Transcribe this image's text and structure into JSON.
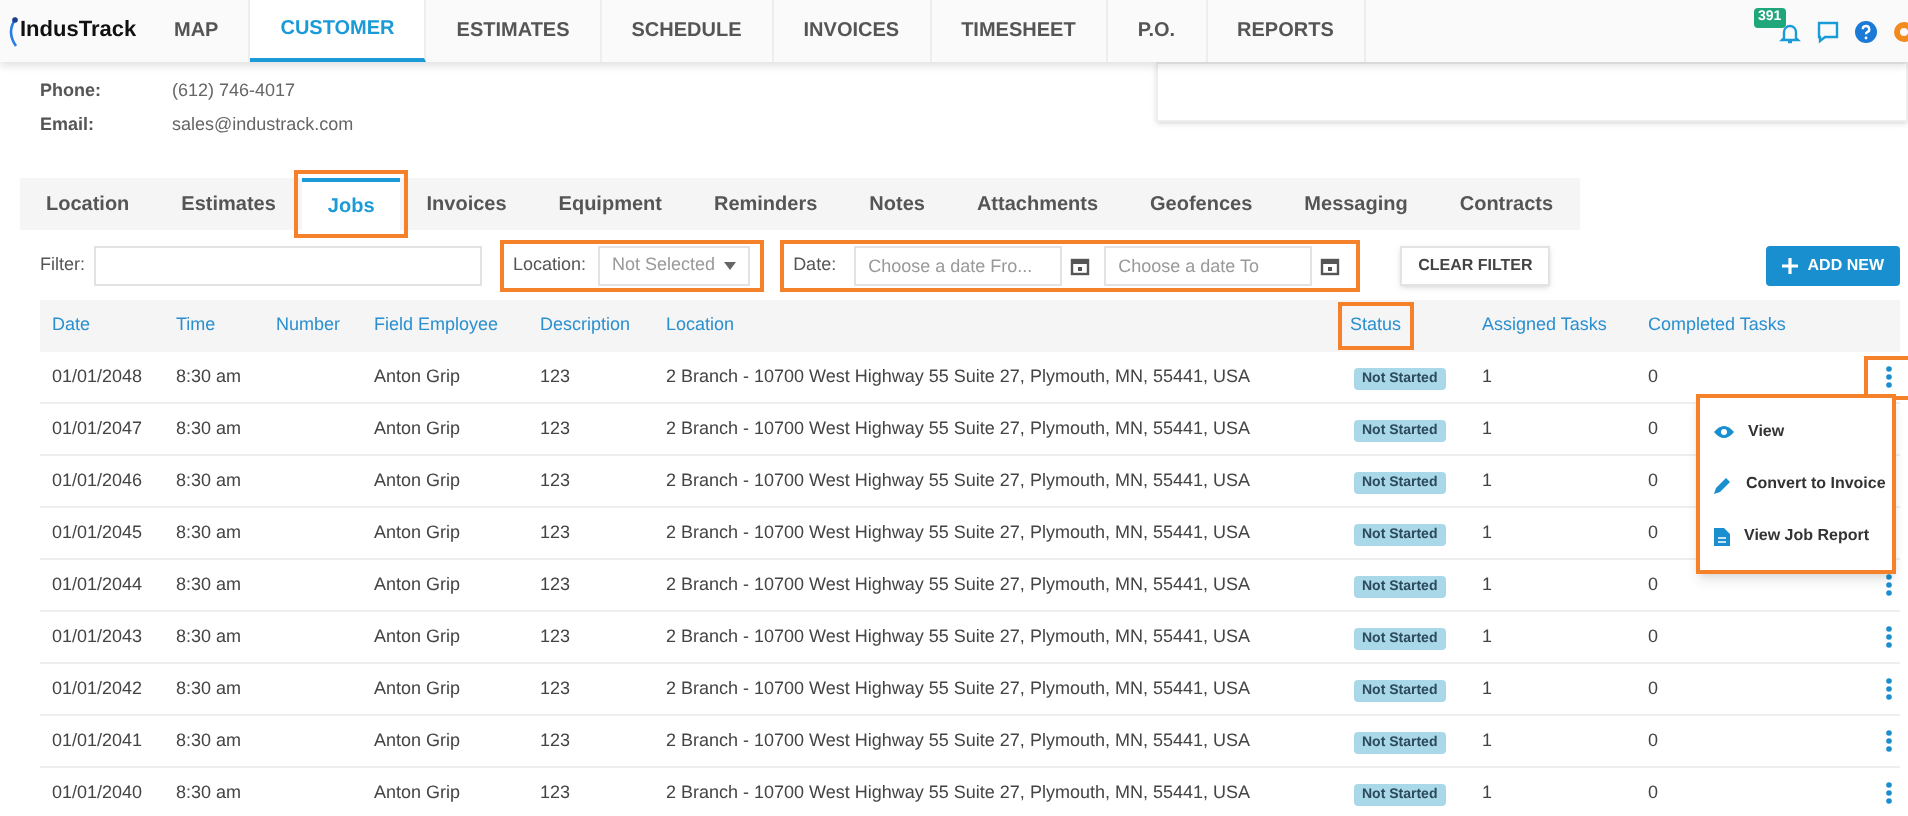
{
  "logo": "IndusTrack",
  "nav": [
    {
      "label": "MAP",
      "selected": false
    },
    {
      "label": "CUSTOMER",
      "selected": true
    },
    {
      "label": "ESTIMATES",
      "selected": false
    },
    {
      "label": "SCHEDULE",
      "selected": false
    },
    {
      "label": "INVOICES",
      "selected": false
    },
    {
      "label": "TIMESHEET",
      "selected": false
    },
    {
      "label": "P.O.",
      "selected": false
    },
    {
      "label": "REPORTS",
      "selected": false
    }
  ],
  "notification_count": "391",
  "contact": [
    {
      "label": "Phone:",
      "value": "(612) 746-4017"
    },
    {
      "label": "Email:",
      "value": "sales@industrack.com"
    }
  ],
  "tabs": [
    {
      "label": "Location",
      "selected": false,
      "highlighted": false
    },
    {
      "label": "Estimates",
      "selected": false,
      "highlighted": false
    },
    {
      "label": "Jobs",
      "selected": true,
      "highlighted": true
    },
    {
      "label": "Invoices",
      "selected": false,
      "highlighted": false
    },
    {
      "label": "Equipment",
      "selected": false,
      "highlighted": false
    },
    {
      "label": "Reminders",
      "selected": false,
      "highlighted": false
    },
    {
      "label": "Notes",
      "selected": false,
      "highlighted": false
    },
    {
      "label": "Attachments",
      "selected": false,
      "highlighted": false
    },
    {
      "label": "Geofences",
      "selected": false,
      "highlighted": false
    },
    {
      "label": "Messaging",
      "selected": false,
      "highlighted": false
    },
    {
      "label": "Contracts",
      "selected": false,
      "highlighted": false
    }
  ],
  "filters": {
    "filter_label": "Filter:",
    "location_label": "Location:",
    "location_value": "Not Selected",
    "date_label": "Date:",
    "date_from_placeholder": "Choose a date Fro...",
    "date_to_placeholder": "Choose a date To",
    "clear_button": "CLEAR FILTER",
    "add_button": "ADD NEW"
  },
  "columns": [
    {
      "label": "Date",
      "highlighted": false
    },
    {
      "label": "Time",
      "highlighted": false
    },
    {
      "label": "Number",
      "highlighted": false
    },
    {
      "label": "Field Employee",
      "highlighted": false
    },
    {
      "label": "Description",
      "highlighted": false
    },
    {
      "label": "Location",
      "highlighted": false
    },
    {
      "label": "Status",
      "highlighted": true
    },
    {
      "label": "Assigned Tasks",
      "highlighted": false
    },
    {
      "label": "Completed Tasks",
      "highlighted": false
    }
  ],
  "rows": [
    {
      "date": "01/01/2048",
      "time": "8:30 am",
      "employee": "Anton Grip",
      "description": "123",
      "location": "2 Branch - 10700 West Highway 55 Suite 27, Plymouth, MN, 55441, USA",
      "status": "Not Started",
      "assigned": "1",
      "completed": "0",
      "menu_open": true
    },
    {
      "date": "01/01/2047",
      "time": "8:30 am",
      "employee": "Anton Grip",
      "description": "123",
      "location": "2 Branch - 10700 West Highway 55 Suite 27, Plymouth, MN, 55441, USA",
      "status": "Not Started",
      "assigned": "1",
      "completed": "0",
      "menu_open": false
    },
    {
      "date": "01/01/2046",
      "time": "8:30 am",
      "employee": "Anton Grip",
      "description": "123",
      "location": "2 Branch - 10700 West Highway 55 Suite 27, Plymouth, MN, 55441, USA",
      "status": "Not Started",
      "assigned": "1",
      "completed": "0",
      "menu_open": false
    },
    {
      "date": "01/01/2045",
      "time": "8:30 am",
      "employee": "Anton Grip",
      "description": "123",
      "location": "2 Branch - 10700 West Highway 55 Suite 27, Plymouth, MN, 55441, USA",
      "status": "Not Started",
      "assigned": "1",
      "completed": "0",
      "menu_open": false
    },
    {
      "date": "01/01/2044",
      "time": "8:30 am",
      "employee": "Anton Grip",
      "description": "123",
      "location": "2 Branch - 10700 West Highway 55 Suite 27, Plymouth, MN, 55441, USA",
      "status": "Not Started",
      "assigned": "1",
      "completed": "0",
      "menu_open": false
    },
    {
      "date": "01/01/2043",
      "time": "8:30 am",
      "employee": "Anton Grip",
      "description": "123",
      "location": "2 Branch - 10700 West Highway 55 Suite 27, Plymouth, MN, 55441, USA",
      "status": "Not Started",
      "assigned": "1",
      "completed": "0",
      "menu_open": false
    },
    {
      "date": "01/01/2042",
      "time": "8:30 am",
      "employee": "Anton Grip",
      "description": "123",
      "location": "2 Branch - 10700 West Highway 55 Suite 27, Plymouth, MN, 55441, USA",
      "status": "Not Started",
      "assigned": "1",
      "completed": "0",
      "menu_open": false
    },
    {
      "date": "01/01/2041",
      "time": "8:30 am",
      "employee": "Anton Grip",
      "description": "123",
      "location": "2 Branch - 10700 West Highway 55 Suite 27, Plymouth, MN, 55441, USA",
      "status": "Not Started",
      "assigned": "1",
      "completed": "0",
      "menu_open": false
    },
    {
      "date": "01/01/2040",
      "time": "8:30 am",
      "employee": "Anton Grip",
      "description": "123",
      "location": "2 Branch - 10700 West Highway 55 Suite 27, Plymouth, MN, 55441, USA",
      "status": "Not Started",
      "assigned": "1",
      "completed": "0",
      "menu_open": false
    }
  ],
  "row_menu": [
    {
      "kind": "view",
      "label": "View"
    },
    {
      "kind": "convert",
      "label": "Convert to Invoice"
    },
    {
      "kind": "report",
      "label": "View Job Report"
    }
  ]
}
